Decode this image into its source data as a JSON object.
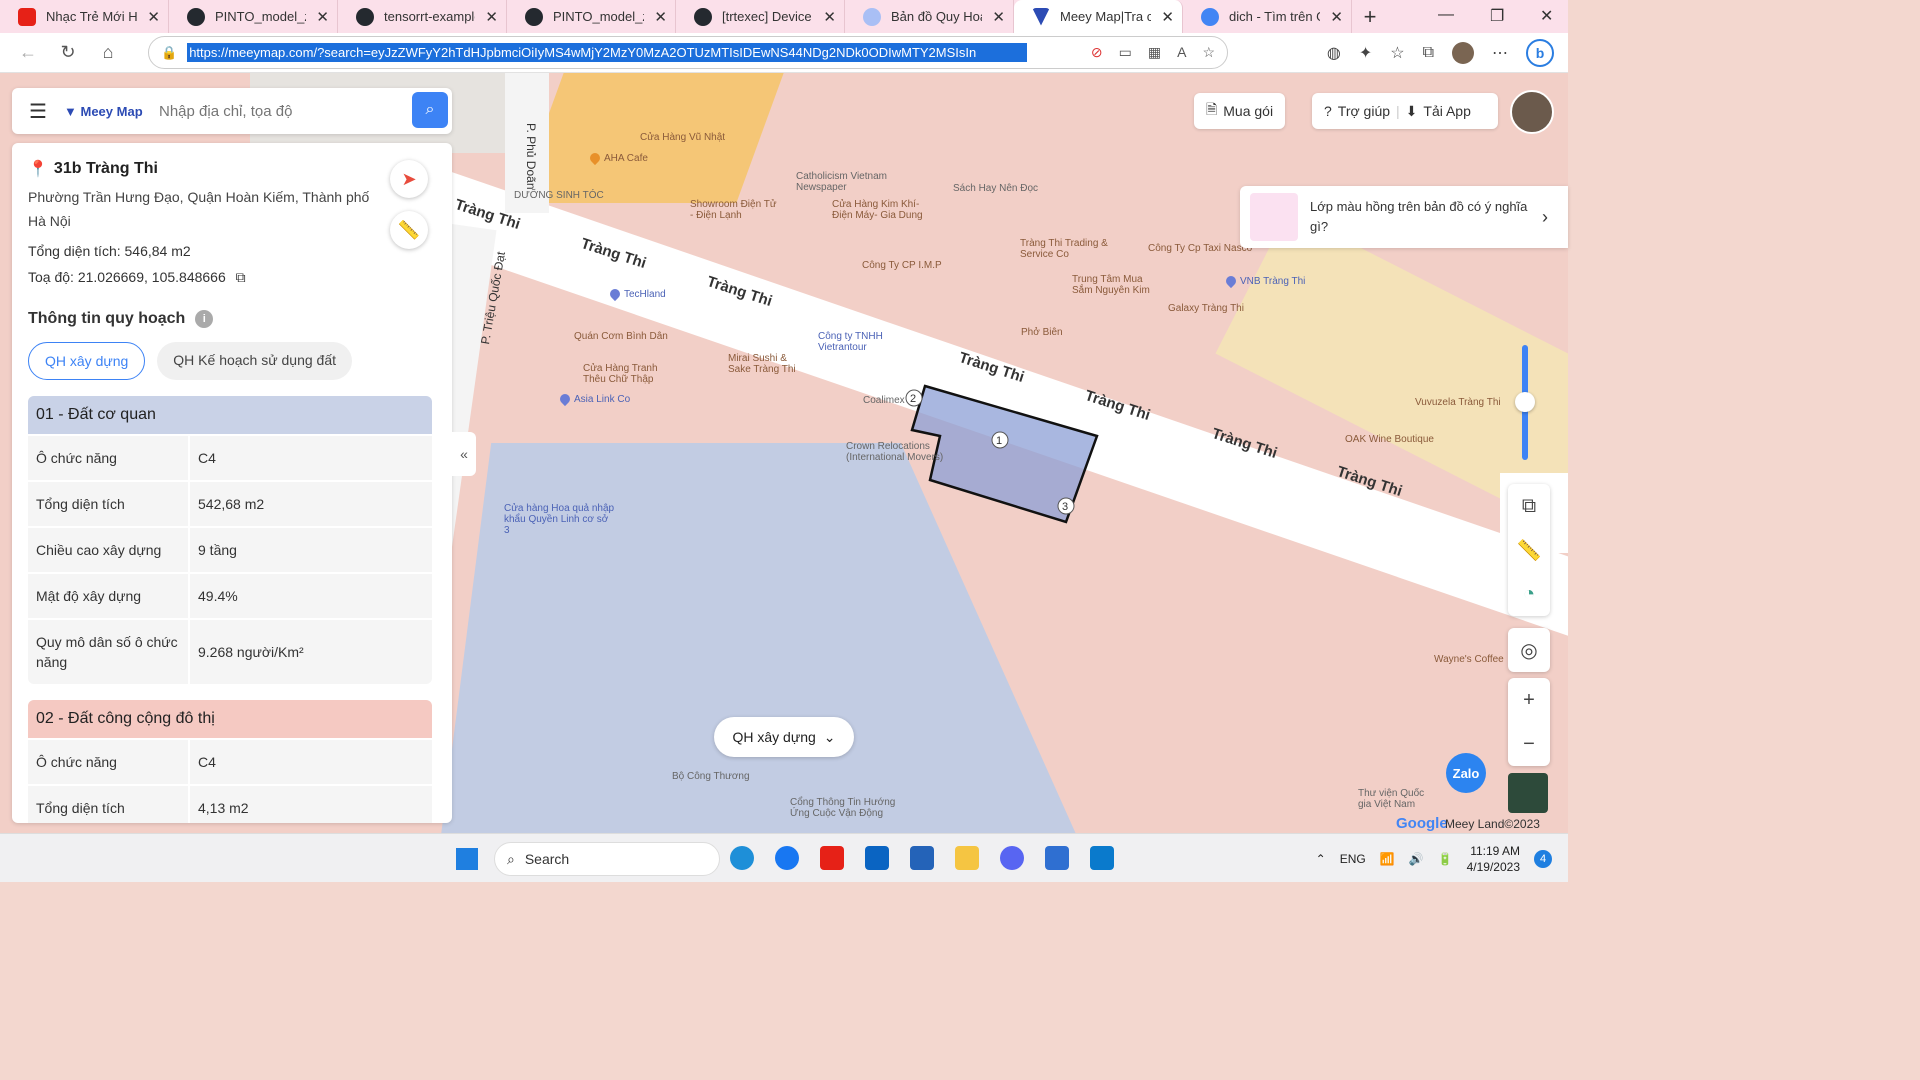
{
  "browser": {
    "tabs": [
      {
        "title": "Nhạc Trẻ Mới Hay",
        "color": "#e62117"
      },
      {
        "title": "PINTO_model_zoo",
        "color": "#24292f"
      },
      {
        "title": "tensorrt-examples",
        "color": "#24292f"
      },
      {
        "title": "PINTO_model_zoo",
        "color": "#24292f"
      },
      {
        "title": "[trtexec] Device m",
        "color": "#24292f"
      },
      {
        "title": "Bản đồ Quy Hoạch",
        "color": "#5b8def"
      },
      {
        "title": "Meey Map|Tra cứu",
        "color": "#2c4bb4"
      },
      {
        "title": "dich - Tìm trên Go",
        "color": "#4285f4"
      }
    ],
    "url": "https://meeymap.com/?search=eyJzZWFyY2hTdHJpbmciOiIyMS4wMjY2MzY0MzA2OTUzMTIsIDEwNS44NDg2NDk0ODIwMTY2MSIsIn"
  },
  "search": {
    "logo": "Meey Map",
    "placeholder": "Nhập địa chỉ, tọa độ"
  },
  "place": {
    "title": "31b Tràng Thi",
    "address": "Phường Trần Hưng Đạo, Quận Hoàn Kiếm, Thành phố Hà Nội",
    "area_label": "Tổng diện tích: ",
    "area_value": "546,84 m2",
    "coord_label": "Toạ độ: ",
    "coord_value": "21.026669, 105.848666"
  },
  "planning": {
    "title": "Thông tin quy hoạch",
    "tab_build": "QH xây dựng",
    "tab_landuse": "QH Kế hoạch sử dụng đất",
    "zones": [
      {
        "name": "01 - Đất cơ quan",
        "rows": [
          {
            "k": "Ô chức năng",
            "v": "C4"
          },
          {
            "k": "Tổng diện tích",
            "v": "542,68 m2"
          },
          {
            "k": "Chiều cao xây dựng",
            "v": "9 tầng"
          },
          {
            "k": "Mật độ xây dựng",
            "v": "49.4%"
          },
          {
            "k": "Quy mô dân số ô chức năng",
            "v": "9.268 người/Km²"
          }
        ]
      },
      {
        "name": "02 - Đất công cộng đô thị",
        "rows": [
          {
            "k": "Ô chức năng",
            "v": "C4"
          },
          {
            "k": "Tổng diện tích",
            "v": "4,13 m2"
          }
        ]
      }
    ]
  },
  "topbar": {
    "buy": "Mua gói",
    "help": "Trợ giúp",
    "app": "Tải App"
  },
  "tip": "Lớp màu hồng trên bản đồ có ý nghĩa gì?",
  "layer_select": "QH xây dựng",
  "map": {
    "streets": [
      "Tràng Thi",
      "P. Phủ Doãn",
      "P. Triệu Quốc Đạt"
    ],
    "pois": [
      "Cửa Hàng Vũ Nhật",
      "AHA Cafe",
      "Catholicism Vietnam Newspaper",
      "Sách Hay Nên Đọc",
      "Showroom Điện Tử - Điện Lạnh",
      "Cửa Hàng Kim Khí-Điện Máy- Gia Dung",
      "Công Ty CP I.M.P",
      "Tràng Thi Trading & Service Co",
      "Công Ty Cp Taxi Nasco",
      "Trung Tâm Mua Sắm Nguyên Kim",
      "VNB Tràng Thi",
      "Galaxy Tràng Thi",
      "TecHland",
      "Quán Cơm Bình Dân",
      "Phở Biên",
      "Công ty TNHH Vietrantour",
      "Mirai Sushi & Sake Tràng Thi",
      "Cửa Hàng Tranh Thêu Chữ Thập",
      "Asia Link Co",
      "Coalimex",
      "Crown Relocations (International Movers)",
      "Vuvuzela Tràng Thi",
      "OAK Wine Boutique",
      "Cửa hàng Hoa quả nhập khẩu Quyền Linh cơ sở 3",
      "Bộ Công Thương",
      "Wayne's Coffee",
      "Thư viện Quốc gia Việt Nam",
      "Cổng Thông Tin Hướng Ứng Cuộc Vận Động",
      "DƯỠNG SINH TÓC"
    ],
    "footer": "Meey Land©2023",
    "google": "Google"
  },
  "taskbar": {
    "search": "Search",
    "lang": "ENG",
    "time": "11:19 AM",
    "date": "4/19/2023",
    "badge": "4"
  }
}
